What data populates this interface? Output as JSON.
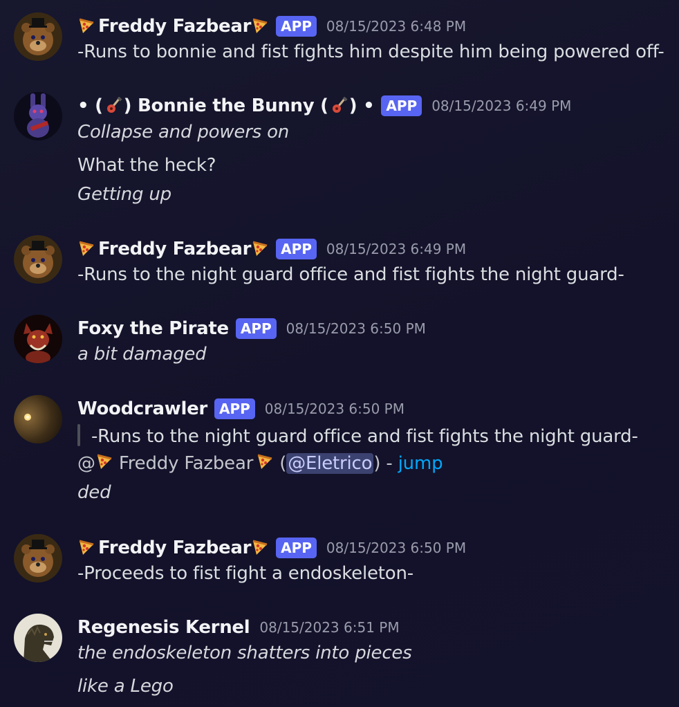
{
  "messages": [
    {
      "author": "Freddy Fazbear",
      "tag": "APP",
      "timestamp": "08/15/2023 6:48 PM",
      "lines": [
        "-Runs to bonnie and fist fights him despite him being powered off-"
      ]
    },
    {
      "author_prefix": "• (",
      "author": ") Bonnie the Bunny (",
      "author_suffix": ") •",
      "tag": "APP",
      "timestamp": "08/15/2023 6:49 PM",
      "lines": [
        "Collapse and powers on",
        "What the heck?",
        "Getting up"
      ]
    },
    {
      "author": "Freddy Fazbear",
      "tag": "APP",
      "timestamp": "08/15/2023 6:49 PM",
      "lines": [
        "-Runs to the night guard office and fist fights the night guard-"
      ]
    },
    {
      "author": "Foxy the Pirate",
      "tag": "APP",
      "timestamp": "08/15/2023 6:50 PM",
      "lines": [
        "a bit damaged"
      ]
    },
    {
      "author": "Woodcrawler",
      "tag": "APP",
      "timestamp": "08/15/2023 6:50 PM",
      "quote": "-Runs to the night guard office and fist fights the night guard-",
      "reply_at": "@",
      "reply_name": " Freddy Fazbear",
      "reply_open": " (",
      "reply_mention": "@Eletrico",
      "reply_close": ") - ",
      "reply_jump": "jump",
      "lines": [
        "ded"
      ]
    },
    {
      "author": "Freddy Fazbear",
      "tag": "APP",
      "timestamp": "08/15/2023 6:50 PM",
      "lines": [
        "-Proceeds to fist fight a endoskeleton-"
      ]
    },
    {
      "author": "Regenesis Kernel",
      "timestamp": "08/15/2023 6:51 PM",
      "lines": [
        "the endoskeleton shatters into pieces",
        "like a Lego"
      ]
    }
  ],
  "icons": {
    "pizza": "pizza-icon",
    "guitar": "guitar-icon"
  },
  "colors": {
    "app_badge": "#5865f2",
    "link": "#00a8fc",
    "mention_bg": "#3c4270"
  }
}
